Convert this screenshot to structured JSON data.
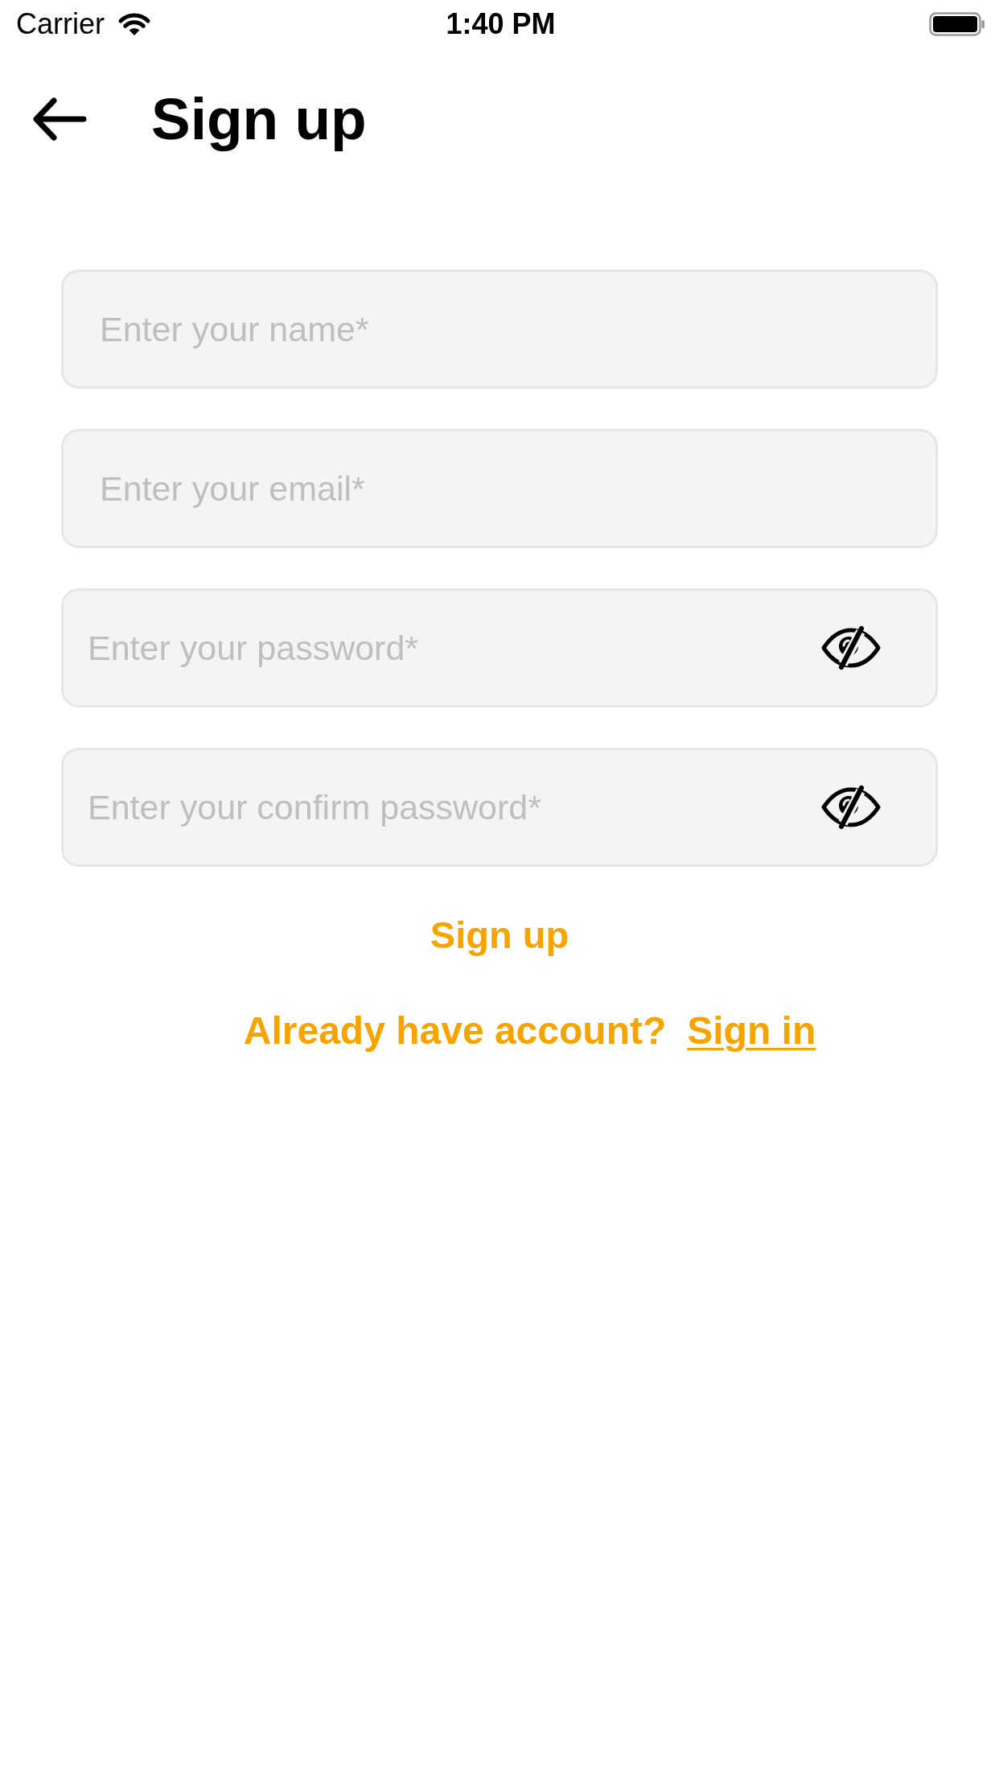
{
  "status_bar": {
    "carrier": "Carrier",
    "time": "1:40 PM"
  },
  "header": {
    "title": "Sign up"
  },
  "fields": [
    {
      "kind": "text",
      "placeholder": "Enter your name*"
    },
    {
      "kind": "text",
      "placeholder": "Enter your email*"
    },
    {
      "kind": "password",
      "placeholder": "Enter your password*"
    },
    {
      "kind": "password",
      "placeholder": "Enter your confirm password*"
    }
  ],
  "primary_action": "Sign up",
  "footer": {
    "prompt": "Already have account?",
    "link": "Sign in"
  }
}
